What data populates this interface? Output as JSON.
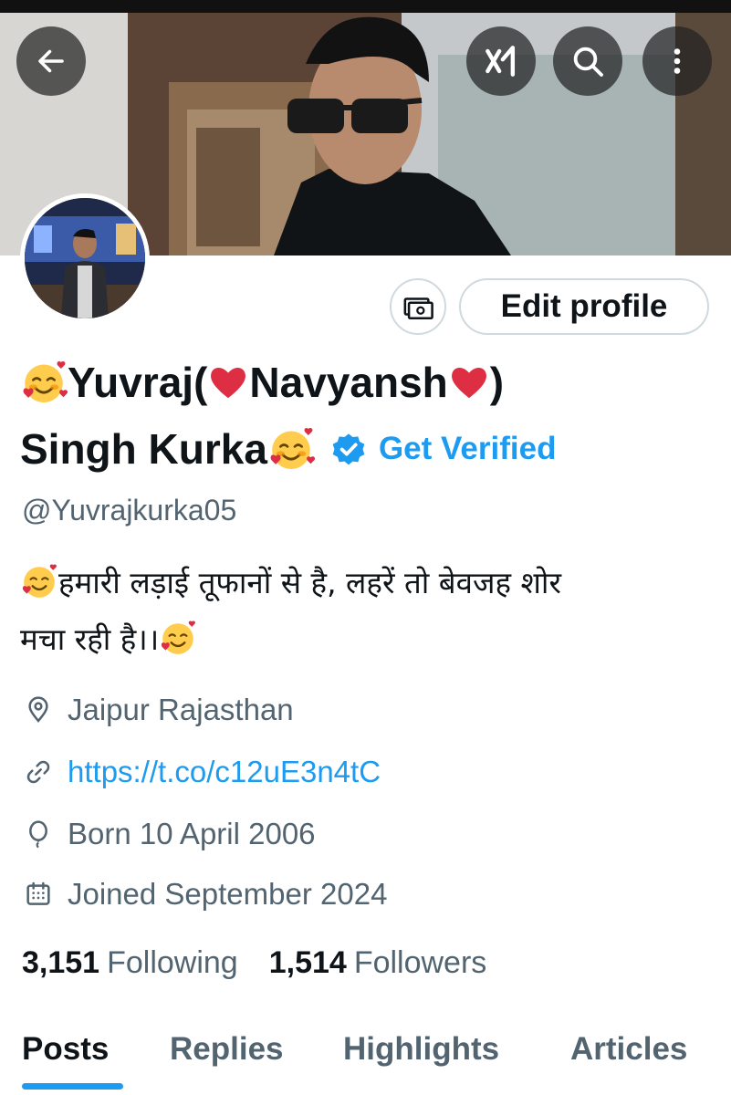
{
  "header": {
    "back_label": "Back",
    "grok_label": "x1",
    "search_label": "Search",
    "more_label": "More"
  },
  "profile": {
    "edit_profile_label": "Edit profile",
    "name_line1_a": "Yuvraj(",
    "name_line1_b": "Navyansh",
    "name_line1_c": ")",
    "name_line2": "Singh Kurka",
    "get_verified_label": "Get Verified",
    "handle": "@Yuvrajkurka05",
    "bio_line1": "हमारी लड़ाई तूफानों से है, लहरें तो बेवजह शोर",
    "bio_line2": "मचा रही है।।",
    "location": "Jaipur Rajasthan",
    "link": "https://t.co/c12uE3n4tC",
    "born": "Born 10 April 2006",
    "joined": "Joined September 2024"
  },
  "stats": {
    "following_count": "3,151",
    "following_label": "Following",
    "followers_count": "1,514",
    "followers_label": "Followers"
  },
  "tabs": [
    {
      "label": "Posts",
      "active": true
    },
    {
      "label": "Replies",
      "active": false
    },
    {
      "label": "Highlights",
      "active": false
    },
    {
      "label": "Articles",
      "active": false
    }
  ],
  "colors": {
    "accent": "#1d9bf0",
    "text_primary": "#0f1419",
    "text_secondary": "#536471",
    "border": "#cfd9de"
  },
  "icons": {
    "back": "arrow-left-icon",
    "grok": "grok-icon",
    "search": "search-icon",
    "more": "more-vertical-icon",
    "money": "money-icon",
    "verified": "verified-badge-icon",
    "location": "location-pin-icon",
    "link": "link-icon",
    "born": "balloon-icon",
    "joined": "calendar-icon",
    "emoji": "smiling-face-with-hearts-emoji",
    "heart": "red-heart-emoji"
  }
}
